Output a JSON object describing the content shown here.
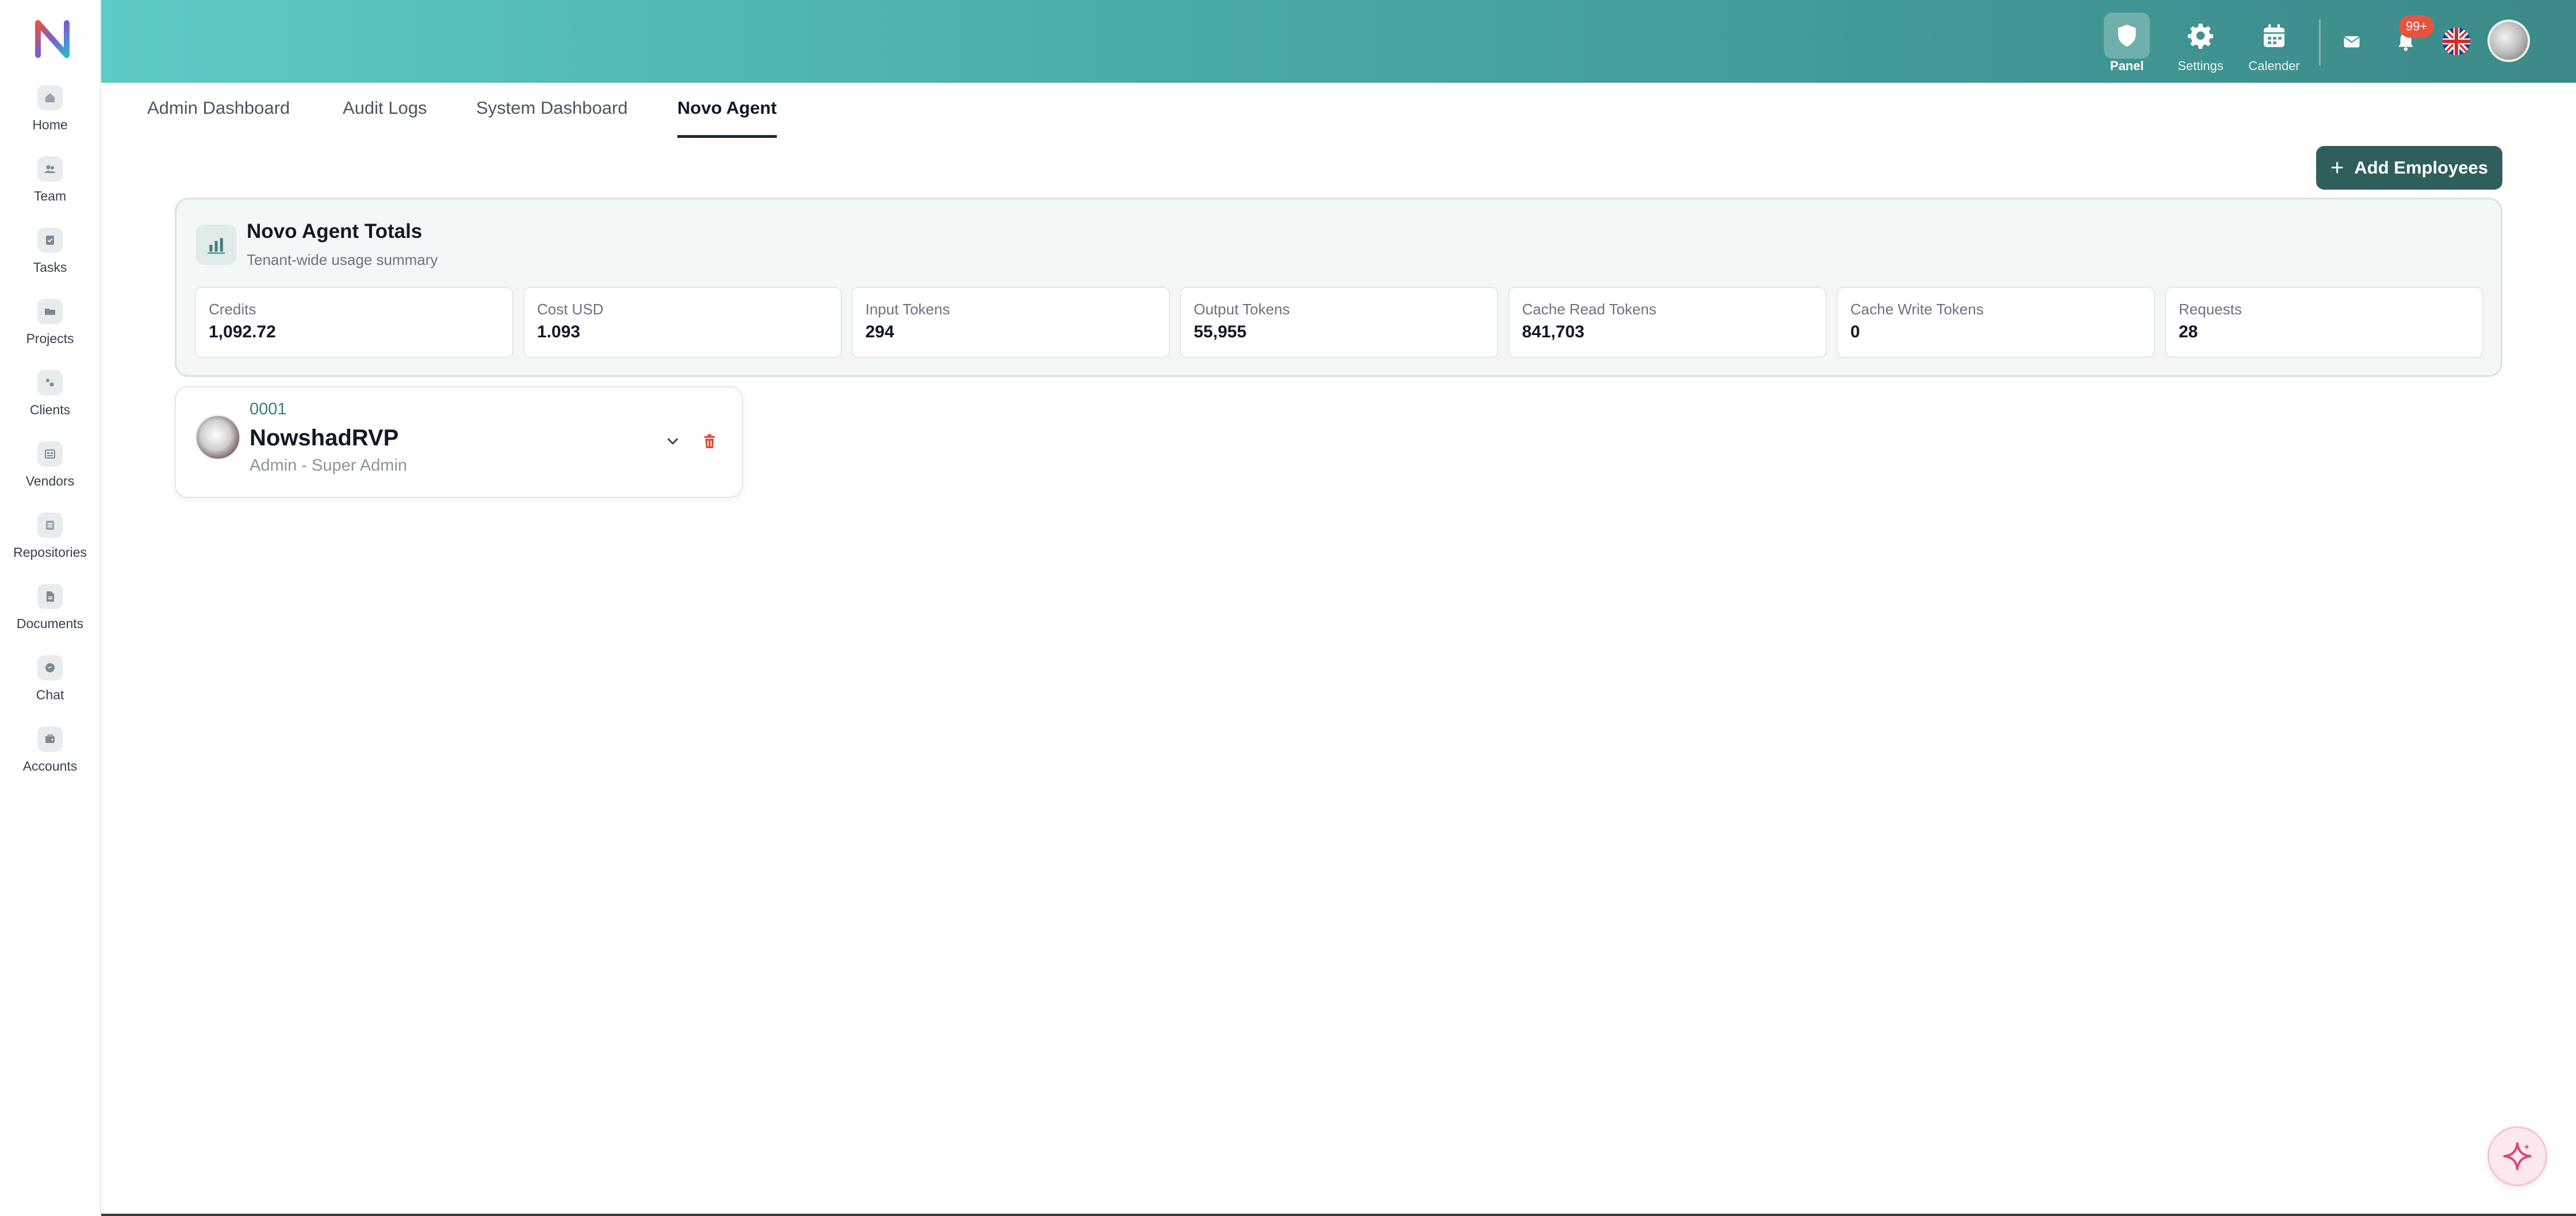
{
  "colors": {
    "header_start": "#5ccbc4",
    "header_end": "#3b8a88",
    "primary": "#2f5f5c",
    "badge": "#e8533f",
    "danger": "#e04a3a"
  },
  "sidebar": {
    "logo_icon": "novo-logo",
    "items": [
      {
        "label": "Home",
        "icon": "home-icon"
      },
      {
        "label": "Team",
        "icon": "team-icon"
      },
      {
        "label": "Tasks",
        "icon": "tasks-icon"
      },
      {
        "label": "Projects",
        "icon": "folder-icon"
      },
      {
        "label": "Clients",
        "icon": "clients-icon"
      },
      {
        "label": "Vendors",
        "icon": "vendors-icon"
      },
      {
        "label": "Repositories",
        "icon": "repositories-icon"
      },
      {
        "label": "Documents",
        "icon": "document-icon"
      },
      {
        "label": "Chat",
        "icon": "chat-icon"
      },
      {
        "label": "Accounts",
        "icon": "wallet-icon"
      }
    ]
  },
  "header": {
    "buttons": [
      {
        "label": "Panel",
        "icon": "shield-icon",
        "active": true
      },
      {
        "label": "Settings",
        "icon": "gear-icon",
        "active": false
      },
      {
        "label": "Calender",
        "icon": "calendar-icon",
        "active": false
      }
    ],
    "notification_badge": "99+"
  },
  "tabs": [
    {
      "label": "Admin Dashboard",
      "active": false
    },
    {
      "label": "Audit Logs",
      "active": false
    },
    {
      "label": "System Dashboard",
      "active": false
    },
    {
      "label": "Novo Agent",
      "active": true
    }
  ],
  "actions": {
    "add_employees_label": "Add Employees"
  },
  "totals": {
    "title": "Novo Agent Totals",
    "subtitle": "Tenant-wide usage summary",
    "stats": [
      {
        "label": "Credits",
        "value": "1,092.72"
      },
      {
        "label": "Cost USD",
        "value": "1.093"
      },
      {
        "label": "Input Tokens",
        "value": "294"
      },
      {
        "label": "Output Tokens",
        "value": "55,955"
      },
      {
        "label": "Cache Read Tokens",
        "value": "841,703"
      },
      {
        "label": "Cache Write Tokens",
        "value": "0"
      },
      {
        "label": "Requests",
        "value": "28"
      }
    ]
  },
  "employee": {
    "code": "0001",
    "name": "NowshadRVP",
    "role": "Admin - Super Admin"
  }
}
